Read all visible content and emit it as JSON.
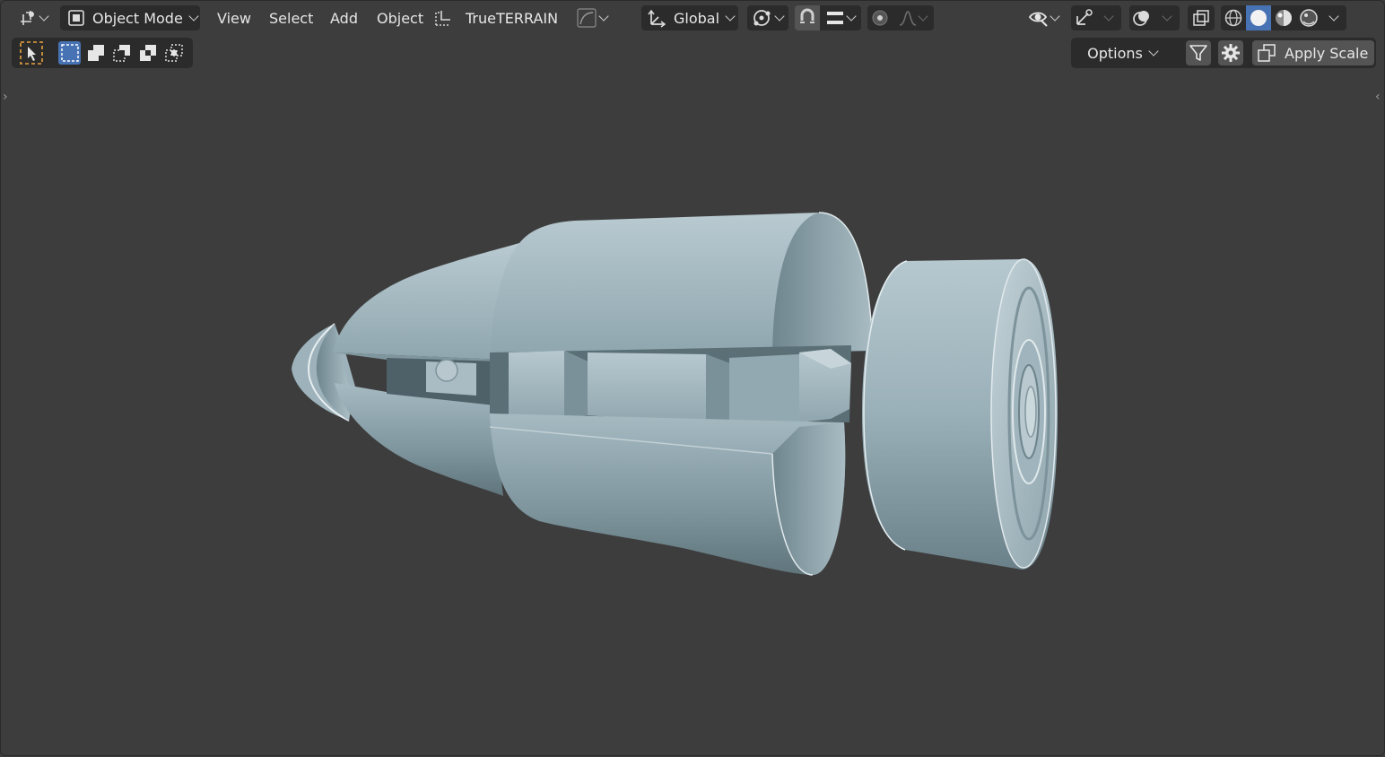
{
  "header": {
    "editor_type_icon": "object-transform-icon",
    "mode": {
      "label": "Object Mode",
      "icon": "object-mode-icon"
    },
    "menus": [
      "View",
      "Select",
      "Add",
      "Object"
    ],
    "addon": {
      "label": "TrueTERRAIN",
      "icon": "trueterrain-icon"
    },
    "transform_orientation": {
      "label": "Global",
      "icon": "orientation-axes-icon"
    },
    "pivot_icon": "pivot-point-icon",
    "snap_icon": "magnet-snap-icon",
    "snap_increment_icon": "snap-increment-icon",
    "proportional_icon": "proportional-editing-icon",
    "falloff_icon": "falloff-curve-icon",
    "right_tools": {
      "visibility_icon": "eye-visibility-icon",
      "gizmo_icon": "gizmo-icon",
      "overlay_icon": "overlay-icon",
      "xray_icon": "xray-icon",
      "shading_modes": [
        "wireframe-icon",
        "solid-icon",
        "material-preview-icon",
        "rendered-icon"
      ],
      "active_shading": "solid-icon"
    }
  },
  "toolbar2": {
    "select_tool_icon": "select-cursor-icon",
    "selection_modes": [
      "select-new-icon",
      "select-extend-icon",
      "select-subtract-icon",
      "select-invert-icon",
      "select-intersect-icon"
    ],
    "options_label": "Options",
    "filter_icon": "filter-icon",
    "settings_icon": "gear-icon",
    "apply_scale": {
      "label": "Apply Scale",
      "icon": "apply-scale-icon"
    }
  },
  "colors": {
    "viewport_bg": "#3d3d3d",
    "header_button": "#2b2b2b",
    "active_blue": "#4772b3",
    "model_light": "#a9bcc4",
    "model_dark": "#6f8790"
  }
}
